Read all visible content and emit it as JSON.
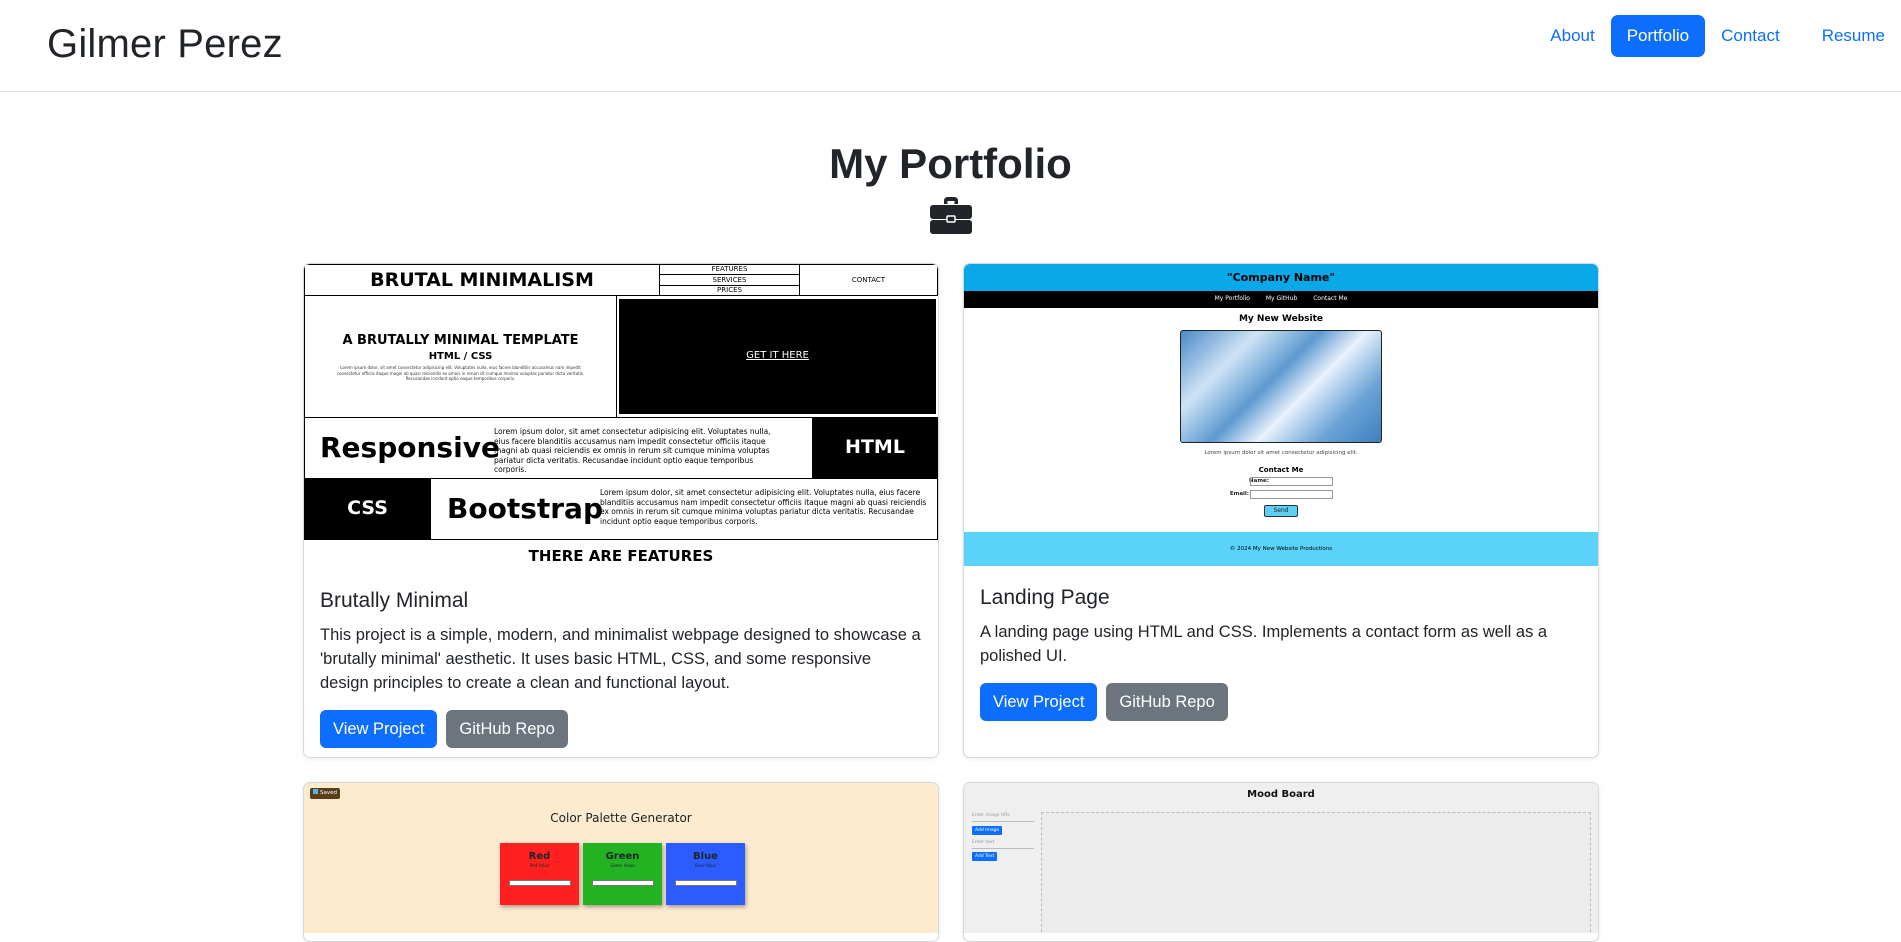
{
  "brand": "Gilmer Perez",
  "nav": {
    "about": "About",
    "portfolio": "Portfolio",
    "contact": "Contact",
    "resume": "Resume"
  },
  "header": {
    "title": "My Portfolio",
    "icon": "briefcase-icon"
  },
  "projects": [
    {
      "title": "Brutally Minimal",
      "description": "This project is a simple, modern, and minimalist webpage designed to showcase a 'brutally minimal' aesthetic. It uses basic HTML, CSS, and some responsive design principles to create a clean and functional layout.",
      "view_label": "View Project",
      "repo_label": "GitHub Repo",
      "thumb": {
        "heading": "BRUTAL MINIMALISM",
        "menu": [
          "FEATURES",
          "SERVICES",
          "PRICES"
        ],
        "contact": "CONTACT",
        "hero_title": "A BRUTALLY MINIMAL TEMPLATE",
        "hero_sub": "HTML / CSS",
        "hero_cta": "GET IT HERE",
        "row1_title": "Responsive",
        "row1_tag": "HTML",
        "row2_tag": "CSS",
        "row2_title": "Bootstrap",
        "lorem": "Lorem ipsum dolor, sit amet consectetur adipisicing elit. Voluptates nulla, eius facere blanditiis accusamus nam impedit consectetur officiis itaque magni ab quasi reiciendis ex omnis in rerum sit cumque minima voluptas pariatur dicta veritatis. Recusandae incidunt optio eaque temporibus corporis.",
        "footer": "THERE ARE FEATURES"
      }
    },
    {
      "title": "Landing Page",
      "description": "A landing page using HTML and CSS. Implements a contact form as well as a polished UI.",
      "view_label": "View Project",
      "repo_label": "GitHub Repo",
      "thumb": {
        "company": "\"Company Name\"",
        "links": [
          "My Portfolio",
          "My GitHub",
          "Contact Me"
        ],
        "site_title": "My New Website",
        "caption": "Lorem ipsum dolor sit amet consectetur adipisicing elit.",
        "form_title": "Contact Me",
        "name_label": "Name:",
        "email_label": "Email:",
        "send": "Send",
        "footer": "© 2024 My New Website Productions"
      }
    },
    {
      "thumb": {
        "badge": "Saved",
        "title": "Color Palette Generator",
        "swatches": [
          {
            "name": "Red",
            "sub": "Red Value",
            "color": "#ff2020"
          },
          {
            "name": "Green",
            "sub": "Green Value",
            "color": "#22b222"
          },
          {
            "name": "Blue",
            "sub": "Blue Value",
            "color": "#2a5cff"
          }
        ]
      }
    },
    {
      "thumb": {
        "title": "Mood Board",
        "image_placeholder": "Enter image URL",
        "add_image": "Add Image",
        "text_placeholder": "Enter text",
        "add_text": "Add Text"
      }
    }
  ]
}
